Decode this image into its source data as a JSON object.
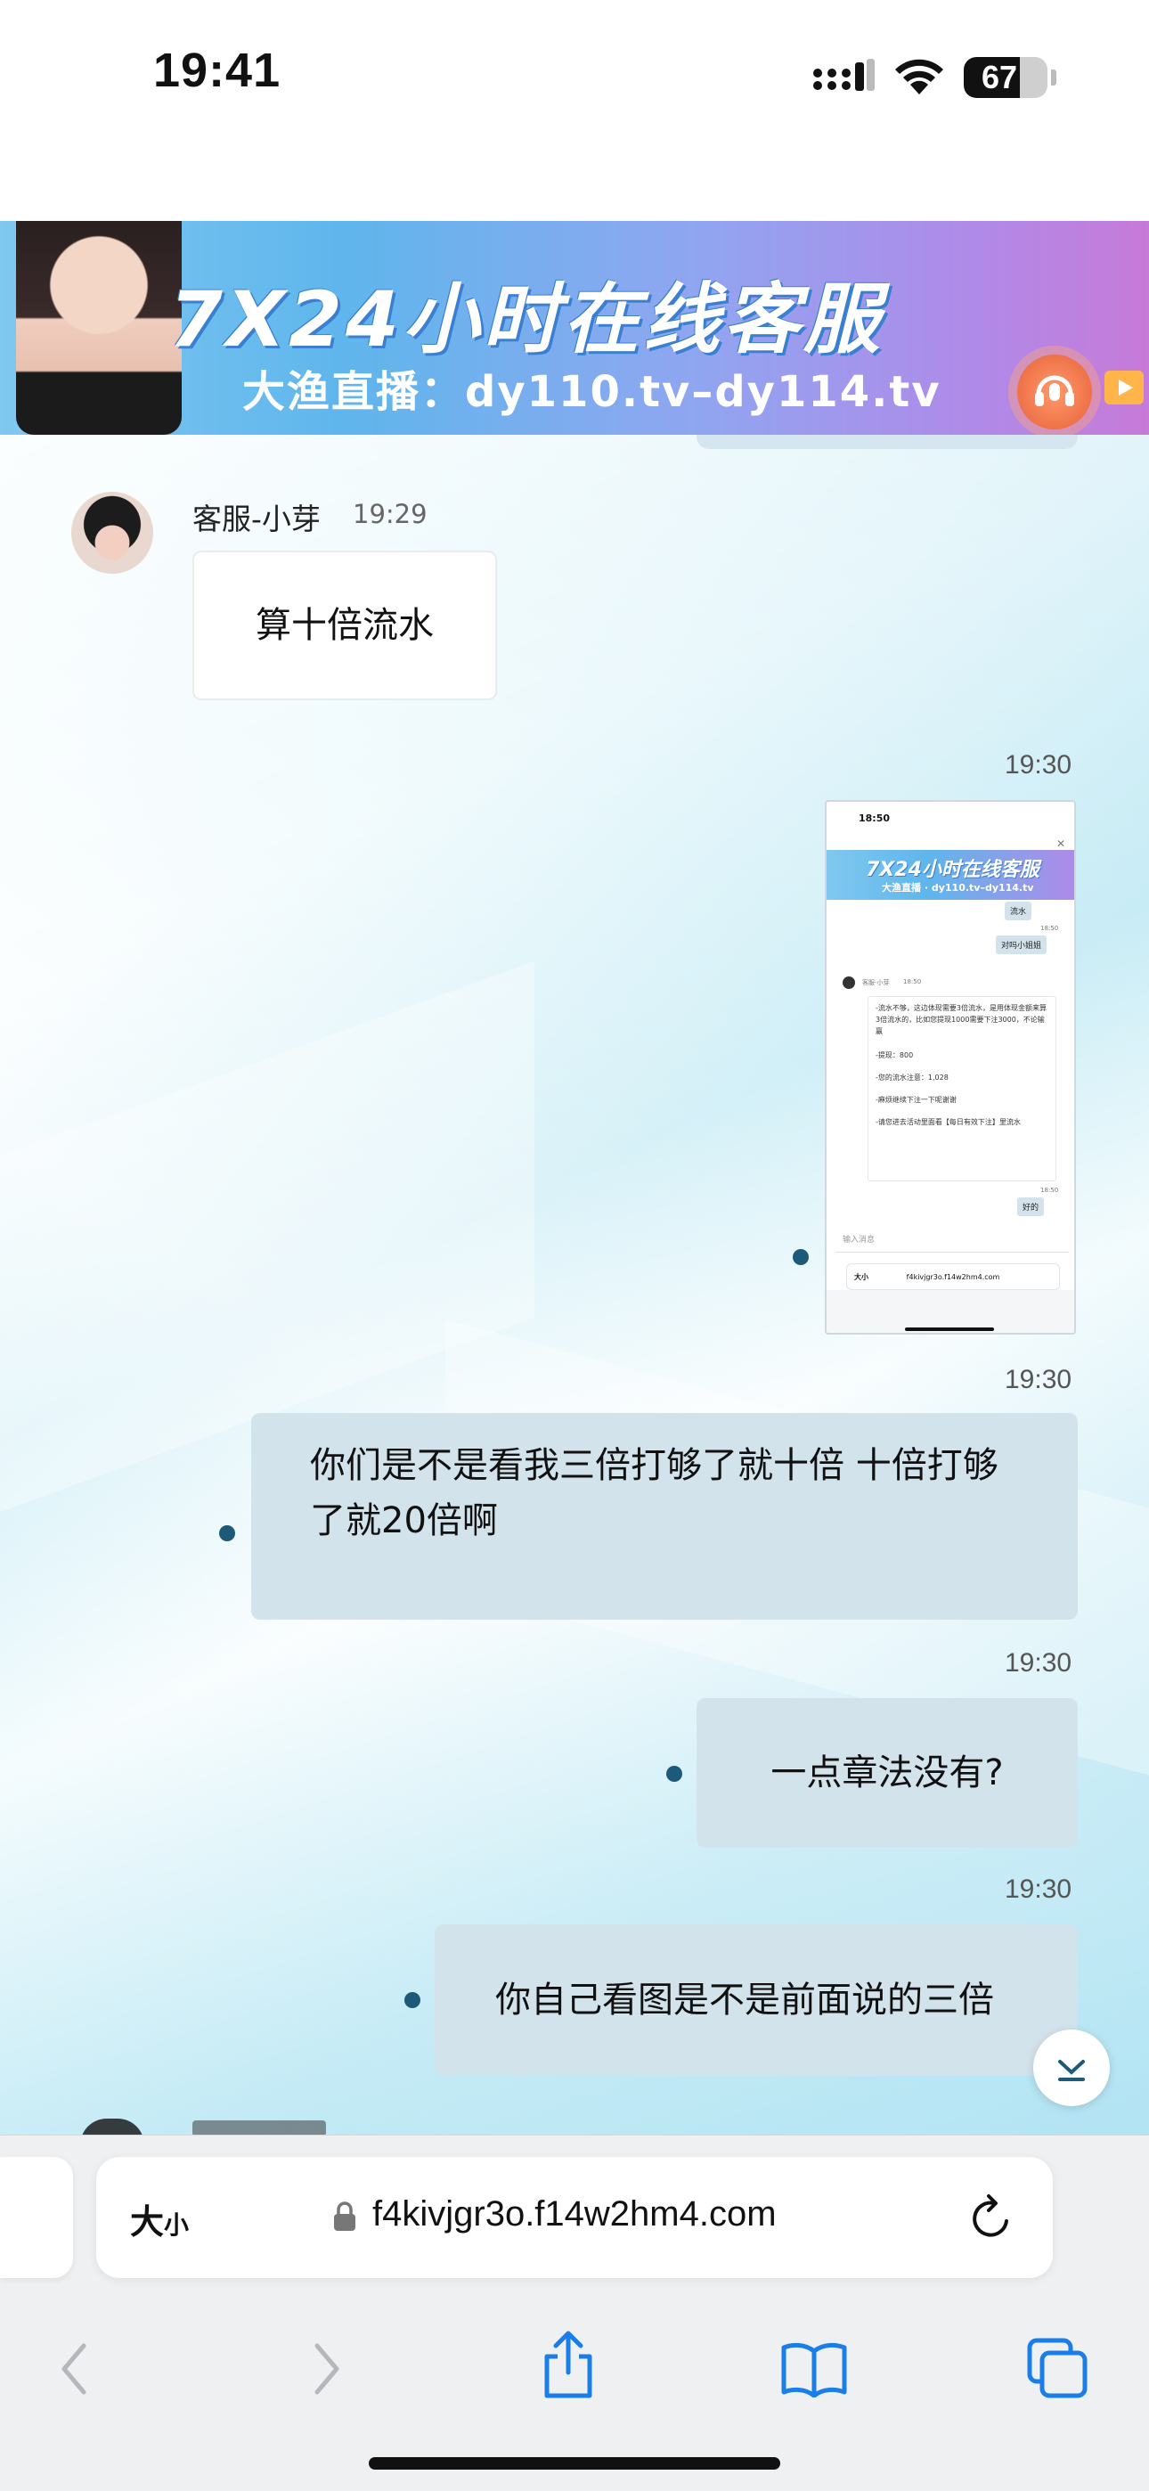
{
  "status_bar": {
    "time": "19:41",
    "battery": "67",
    "battery_level": 0.67
  },
  "banner": {
    "title": "7X24小时在线客服",
    "subtitle": "大渔直播：dy110.tv–dy114.tv"
  },
  "chat": {
    "agent_message": {
      "sender": "客服-小芽",
      "time": "19:29",
      "text": "算十倍流水"
    },
    "user_messages": [
      {
        "time": "19:30",
        "type": "image"
      },
      {
        "time": "19:30",
        "text": "你们是不是看我三倍打够了就十倍 十倍打够了就20倍啊"
      },
      {
        "time": "19:30",
        "text": "一点章法没有?"
      },
      {
        "time": "19:30",
        "text": "你自己看图是不是前面说的三倍"
      }
    ]
  },
  "thumbnail": {
    "time": "18:50",
    "banner_title": "7X24小时在线客服",
    "banner_subtitle": "大渔直播 · dy110.tv–dy114.tv",
    "bubble1": "流水",
    "small_time1": "18:50",
    "bubble2": "对吗小姐姐",
    "agent_name": "客服-小芽",
    "agent_time": "18:50",
    "agent_lines": [
      "-流水不够，这边体现需要3倍流水，是用体现金额来算3倍流水的，比如您提现1000需要下注3000，不论输赢",
      "-提现：800",
      "-您的流水注意：1,028",
      "-麻烦继续下注一下呢谢谢",
      "-请您进去活动里面看【每日有效下注】里流水"
    ],
    "small_time2": "18:50",
    "bubble3": "好的",
    "input_placeholder": "输入消息",
    "url_text_size": "大小",
    "url": "f4kivjgr3o.f14w2hm4.com"
  },
  "browser": {
    "text_size_big": "大",
    "text_size_small": "小",
    "url": "f4kivjgr3o.f14w2hm4.com"
  }
}
